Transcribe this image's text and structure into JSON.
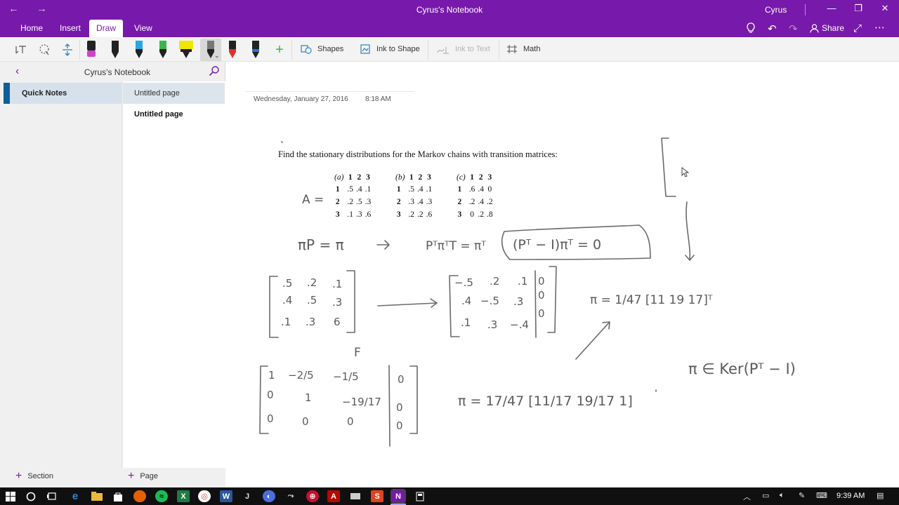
{
  "window": {
    "title": "Cyrus's Notebook",
    "user": "Cyrus"
  },
  "ribbon": {
    "tabs": [
      "Home",
      "Insert",
      "Draw",
      "View"
    ],
    "active_tab": "Draw",
    "share_label": "Share"
  },
  "drawbar": {
    "shapes_label": "Shapes",
    "ink_to_shape_label": "Ink to Shape",
    "ink_to_text_label": "Ink to Text",
    "math_label": "Math",
    "pen_colors": [
      "#cc44cc",
      "#222222",
      "#2aa6e0",
      "#3bb54a",
      "#f2e600",
      "#555555",
      "#d9332b",
      "#2d6fd6"
    ]
  },
  "navigation": {
    "notebook_name": "Cyrus's Notebook",
    "sections": [
      {
        "label": "Quick Notes",
        "color": "#0f5e96"
      }
    ],
    "pages": [
      {
        "label": "Untitled page",
        "selected": true
      },
      {
        "label": "Untitled page",
        "selected": false
      }
    ],
    "add_section_label": "Section",
    "add_page_label": "Page"
  },
  "page": {
    "date": "Wednesday, January 27, 2016",
    "time": "8:18 AM",
    "problem_text": "Find the stationary distributions for the Markov chains with transition matrices:",
    "matrices": [
      {
        "label": "(a)",
        "cols": [
          "1",
          "2",
          "3"
        ],
        "rows": [
          {
            "h": "1",
            "v": [
              ".5",
              ".4",
              ".1"
            ]
          },
          {
            "h": "2",
            "v": [
              ".2",
              ".5",
              ".3"
            ]
          },
          {
            "h": "3",
            "v": [
              ".1",
              ".3",
              ".6"
            ]
          }
        ]
      },
      {
        "label": "(b)",
        "cols": [
          "1",
          "2",
          "3"
        ],
        "rows": [
          {
            "h": "1",
            "v": [
              ".5",
              ".4",
              ".1"
            ]
          },
          {
            "h": "2",
            "v": [
              ".3",
              ".4",
              ".3"
            ]
          },
          {
            "h": "3",
            "v": [
              ".2",
              ".2",
              ".6"
            ]
          }
        ]
      },
      {
        "label": "(c)",
        "cols": [
          "1",
          "2",
          "3"
        ],
        "rows": [
          {
            "h": "1",
            "v": [
              ".6",
              ".4",
              "0"
            ]
          },
          {
            "h": "2",
            "v": [
              ".2",
              ".4",
              ".2"
            ]
          },
          {
            "h": "3",
            "v": [
              "0",
              ".2",
              ".8"
            ]
          }
        ]
      }
    ],
    "ink": {
      "a_label": "A =",
      "eq1": "πP = π",
      "eq2": "PᵀπᵀT = πᵀ",
      "eq3": "(Pᵀ − I)πᵀ = 0",
      "mat_left": [
        [
          ".5",
          ".2",
          ".1"
        ],
        [
          ".4",
          ".5",
          ".3"
        ],
        [
          ".1",
          ".3",
          "6"
        ]
      ],
      "mat_right": [
        [
          "−.5",
          ".2",
          ".1"
        ],
        [
          ".4",
          "−.5",
          ".3"
        ],
        [
          ".1",
          ".3",
          "−.4"
        ]
      ],
      "mat_right_aug": [
        "0",
        "0",
        "0"
      ],
      "f_label": "F",
      "rref": [
        [
          "1",
          "−2/5",
          "−1/5"
        ],
        [
          "0",
          "1",
          "−19/17"
        ],
        [
          "0",
          "0",
          "0"
        ]
      ],
      "rref_aug": [
        "0",
        "0",
        "0"
      ],
      "pi_result_1": "π = 1/47 [11  19  17]ᵀ",
      "pi_result_2": "π = 17/47 [11/17  19/17  1]",
      "kernel": "π ∈ Ker(Pᵀ − I)"
    }
  },
  "taskbar": {
    "time": "9:39 AM"
  }
}
